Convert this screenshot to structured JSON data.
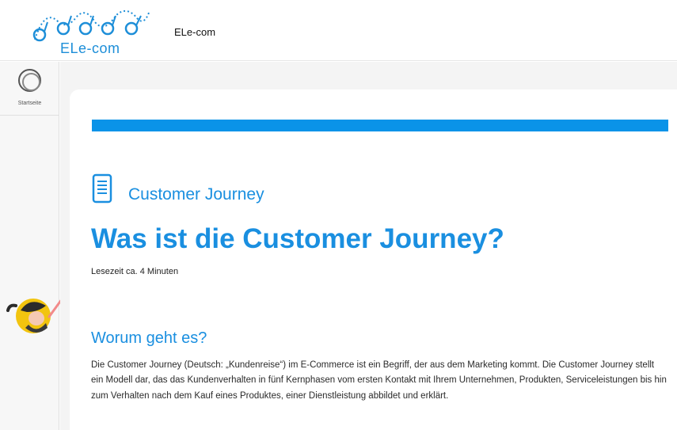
{
  "header": {
    "logo_text": "ELe-com",
    "app_title": "ELe-com"
  },
  "sidebar": {
    "items": [
      {
        "label": "Startseite",
        "icon": "home-ring-icon"
      }
    ]
  },
  "progress": {
    "fraction": 1.0,
    "color": "#0a93e8"
  },
  "content": {
    "section_label": "Customer Journey",
    "title": "Was ist die Customer Journey?",
    "reading_time": "Lesezeit ca. 4 Minuten",
    "subheading": "Worum geht es?",
    "paragraph": "Die Customer Journey (Deutsch: „Kundenreise“) im E-Commerce ist ein Begriff, der aus dem Marketing kommt. Die Customer Journey stellt ein Modell dar, das das Kundenverhalten in fünf Kernphasen vom ersten Kontakt mit Ihrem Unternehmen, Produkten, Serviceleistungen bis hin zum Verhalten nach dem Kauf eines Produktes, einer Dienstleistung abbildet und erklärt."
  },
  "colors": {
    "accent": "#1a8fe0",
    "sidebar_bg": "#f7f7f7",
    "content_bg": "#f4f4f4"
  }
}
